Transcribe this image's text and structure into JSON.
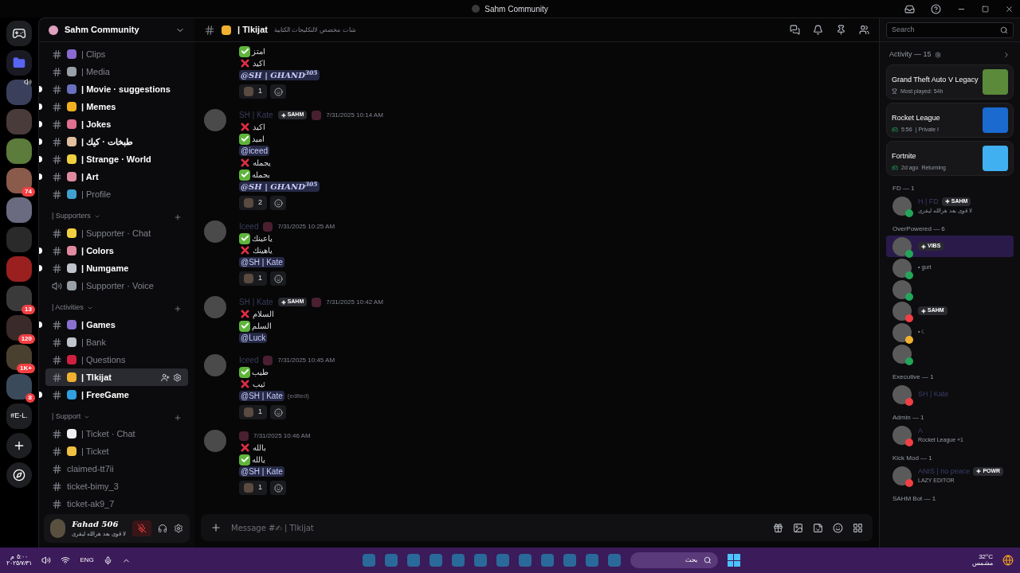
{
  "window": {
    "title": "Sahm Community"
  },
  "servers": [
    {
      "kind": "discord"
    },
    {
      "kind": "folder"
    },
    {
      "kind": "server",
      "color": "#3a3f5c",
      "speaker": true
    },
    {
      "kind": "server",
      "color": "#4a3b3b"
    },
    {
      "kind": "server",
      "color": "#5b7c3a"
    },
    {
      "kind": "server",
      "color": "#8a5a4a",
      "badge": "74"
    },
    {
      "kind": "server",
      "color": "#6a6a80"
    },
    {
      "kind": "server",
      "color": "#2a2a2a"
    },
    {
      "kind": "server",
      "color": "#9a2020"
    },
    {
      "kind": "server",
      "color": "#3a3a3a",
      "badge": "13"
    },
    {
      "kind": "server",
      "color": "#3a2a2a",
      "badge": "120"
    },
    {
      "kind": "server",
      "color": "#4a4030",
      "badge": "1K+"
    },
    {
      "kind": "server",
      "color": "#3a4a5a",
      "badge": "8"
    },
    {
      "kind": "text",
      "label": "#E-L."
    },
    {
      "kind": "add"
    },
    {
      "kind": "explore"
    }
  ],
  "sidebar": {
    "server_name": "Sahm Community",
    "groups": [
      {
        "channels": [
          {
            "name": "| Clips",
            "color": "#8a6ad0",
            "unread": false,
            "selected": false,
            "kind": "text"
          },
          {
            "name": "| Media",
            "color": "#9aa0a8",
            "unread": false,
            "selected": false,
            "kind": "text"
          },
          {
            "name": "| Movie · suggestions",
            "color": "#6a70c0",
            "unread": true,
            "selected": false,
            "kind": "text"
          },
          {
            "name": "| Memes",
            "color": "#f0b020",
            "unread": true,
            "selected": false,
            "kind": "text"
          },
          {
            "name": "| Jokes",
            "color": "#e07090",
            "unread": true,
            "selected": false,
            "kind": "text"
          },
          {
            "name": "| طبخات · كيك",
            "color": "#e0c0a0",
            "unread": true,
            "selected": false,
            "kind": "text"
          },
          {
            "name": "| Strange · World",
            "color": "#f0d040",
            "unread": true,
            "selected": false,
            "kind": "text"
          },
          {
            "name": "| Art",
            "color": "#e08aa0",
            "unread": true,
            "selected": false,
            "kind": "text"
          },
          {
            "name": "| Profile",
            "color": "#40a0d0",
            "unread": false,
            "selected": false,
            "kind": "text"
          }
        ]
      },
      {
        "name": "| Supporters",
        "channels": [
          {
            "name": "| Supporter · Chat",
            "color": "#f0d040",
            "unread": false,
            "selected": false,
            "kind": "text"
          },
          {
            "name": "| Colors",
            "color": "#e08aa0",
            "unread": true,
            "selected": false,
            "kind": "text"
          },
          {
            "name": "| Numgame",
            "color": "#c0c4cc",
            "unread": true,
            "selected": false,
            "kind": "text"
          },
          {
            "name": "| Supporter · Voice",
            "color": "#9aa0a8",
            "unread": false,
            "selected": false,
            "kind": "voice"
          }
        ]
      },
      {
        "name": "| Activities",
        "channels": [
          {
            "name": "| Games",
            "color": "#8a70d0",
            "unread": true,
            "selected": false,
            "kind": "text"
          },
          {
            "name": "| Bank",
            "color": "#c0c4cc",
            "unread": false,
            "selected": false,
            "kind": "text"
          },
          {
            "name": "| Questions",
            "color": "#d02040",
            "unread": false,
            "selected": false,
            "kind": "text"
          },
          {
            "name": "| Tlkijat",
            "color": "#f0b030",
            "unread": false,
            "selected": true,
            "kind": "text"
          },
          {
            "name": "| FreeGame",
            "color": "#30a0e0",
            "unread": true,
            "selected": false,
            "kind": "text"
          }
        ]
      },
      {
        "name": "| Support",
        "channels": [
          {
            "name": "| Ticket · Chat",
            "color": "#f0f0f0",
            "unread": false,
            "selected": false,
            "kind": "text"
          },
          {
            "name": "| Ticket",
            "color": "#f0c040",
            "unread": false,
            "selected": false,
            "kind": "text"
          },
          {
            "name": "claimed-tt7ii",
            "unread": false,
            "selected": false,
            "kind": "text"
          },
          {
            "name": "ticket-bimy_3",
            "unread": false,
            "selected": false,
            "kind": "text"
          },
          {
            "name": "ticket-ak9_7",
            "unread": false,
            "selected": false,
            "kind": "text"
          }
        ]
      }
    ]
  },
  "user": {
    "name": "Fahad 506",
    "status": "لا قوى بعد هرالله ليقرى",
    "muted": true
  },
  "header": {
    "channel": "| Tlkijat",
    "topic": "شات مخصص لالتكليجات الكتابية"
  },
  "messages": [
    {
      "lines": [
        {
          "kind": "check",
          "text": "امتز"
        },
        {
          "kind": "cross",
          "text": "اكيد"
        },
        {
          "kind": "mention",
          "text": "@SH | GHAND$^{305}$",
          "fancy": true
        }
      ],
      "reactions": [
        "1"
      ]
    },
    {
      "author": "SH | Kate",
      "badge": "SAHM",
      "time": "7/31/2025 10:14 AM",
      "lines": [
        {
          "kind": "cross",
          "text": "اكيد"
        },
        {
          "kind": "check",
          "text": "اميد"
        },
        {
          "kind": "mention",
          "text": "@iceed",
          "fancy": false
        },
        {
          "kind": "cross",
          "text": "يجمله"
        },
        {
          "kind": "check",
          "text": "بجمله"
        },
        {
          "kind": "mention",
          "text": "@SH | GHAND$^{305}$",
          "fancy": true
        }
      ],
      "reactions": [
        "2"
      ]
    },
    {
      "author": "Iceed",
      "time": "7/31/2025 10:25 AM",
      "lines": [
        {
          "kind": "check",
          "text": "ياعينك"
        },
        {
          "kind": "cross",
          "text": "ياهينك"
        },
        {
          "kind": "mention",
          "text": "@SH | Kate",
          "fancy": false
        }
      ],
      "reactions": [
        "1"
      ]
    },
    {
      "author": "SH | Kate",
      "badge": "SAHM",
      "time": "7/31/2025 10:42 AM",
      "lines": [
        {
          "kind": "cross",
          "text": "السلام"
        },
        {
          "kind": "check",
          "text": "السلم"
        },
        {
          "kind": "mention",
          "text": "@Luck",
          "fancy": false
        }
      ]
    },
    {
      "author": "Iceed",
      "time": "7/31/2025 10:45 AM",
      "lines": [
        {
          "kind": "check",
          "text": "طيب"
        },
        {
          "kind": "cross",
          "text": "ثيب"
        },
        {
          "kind": "mention",
          "text": "@SH | Kate",
          "fancy": false,
          "edited": "(edited)"
        }
      ],
      "reactions": [
        "1"
      ]
    },
    {
      "time": "7/31/2025 10:46 AM",
      "lines": [
        {
          "kind": "cross",
          "text": "بالله"
        },
        {
          "kind": "check",
          "text": "يالله"
        },
        {
          "kind": "mention",
          "text": "@SH | Kate",
          "fancy": false
        }
      ],
      "reactions": [
        "1"
      ]
    }
  ],
  "composer": {
    "placeholder": "Message #✍ | Tlkijat"
  },
  "search": {
    "placeholder": "Search"
  },
  "activity": {
    "title": "Activity — 15",
    "cards": [
      {
        "game": "Grand Theft Auto V Legacy",
        "detail": "Most played: 54h",
        "color": "#5a8a3a"
      },
      {
        "game": "Rocket League",
        "detail": "5:56",
        "extra": "| Private I",
        "color": "#1a6ad0"
      },
      {
        "game": "Fortnite",
        "detail": "2d ago",
        "extra": "Returning",
        "color": "#40b0f0"
      }
    ]
  },
  "member_groups": [
    {
      "name": "FD — 1",
      "members": [
        {
          "name": "H | FD",
          "badge": "SAHM",
          "status": "لا قوى بعد هرالله ليقرى",
          "color": "#23a55a",
          "banner": false
        }
      ]
    },
    {
      "name": "OverPowered — 6",
      "members": [
        {
          "badge": "VIBS",
          "banner": true,
          "color": "#23a55a"
        },
        {
          "status": "• gurt",
          "color": "#23a55a",
          "banner": false
        },
        {
          "color": "#23a55a",
          "banner": false
        },
        {
          "badge": "SAHM",
          "color": "#f23f43",
          "banner": false
        },
        {
          "status": "• ☾",
          "color": "#f0b232",
          "banner": false
        },
        {
          "color": "#23a55a",
          "banner": false
        }
      ]
    },
    {
      "name": "Executive — 1",
      "members": [
        {
          "name": "SH | Kate",
          "color": "#f23f43",
          "banner": false
        }
      ]
    },
    {
      "name": "Admin — 1",
      "members": [
        {
          "name": "A",
          "status": "Rocket League +1",
          "color": "#f23f43",
          "banner": false
        }
      ]
    },
    {
      "name": "Kick Mod — 1",
      "members": [
        {
          "name": "ANIS | no peace",
          "badge": "POWR",
          "status": "LAZY EDITOR",
          "color": "#f23f43",
          "banner": false
        }
      ]
    },
    {
      "name": "SAHM Bot — 1"
    }
  ],
  "taskbar": {
    "time": "٥:٠٠ م",
    "date": "٢٠٢٥/٧/٣١",
    "language": "ENG",
    "search": "بحث",
    "temperature": "32°C",
    "weather": "مشمس"
  }
}
